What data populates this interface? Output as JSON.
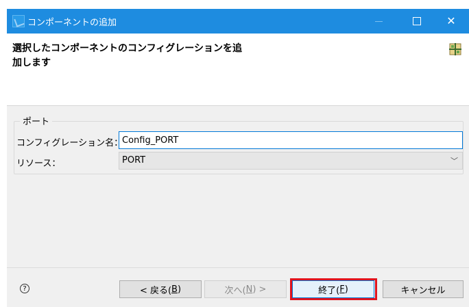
{
  "window": {
    "title": "コンポーネントの追加",
    "icons": {
      "app": "eclipse-wizard-icon",
      "minimize": "minimize-icon",
      "maximize": "maximize-icon",
      "close": "close-icon"
    }
  },
  "header": {
    "message_line1": "選択したコンポーネントのコンフィグレーションを追",
    "message_line2": "加します",
    "icon": "component-grid-icon"
  },
  "form": {
    "group_title": "ポート",
    "config_name_label": "コンフィグレーション名：",
    "config_name_value": "Config_PORT",
    "resource_label": "リソース：",
    "resource_value": "PORT"
  },
  "footer": {
    "help_icon": "help-icon",
    "back_text": "< 戻る(",
    "back_key": "B",
    "back_end": ")",
    "next_text": "次へ(",
    "next_key": "N",
    "next_end": ") >",
    "finish_text": "終了(",
    "finish_key": "F",
    "finish_end": ")",
    "cancel_label": "キャンセル",
    "highlight_color": "#e0141e"
  }
}
